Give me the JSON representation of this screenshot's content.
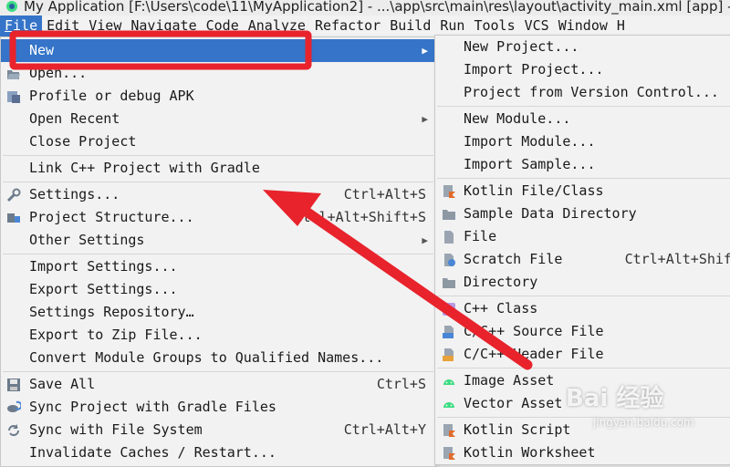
{
  "titlebar": {
    "text": "My Application [F:\\Users\\code\\11\\MyApplication2] - ...\\app\\src\\main\\res\\layout\\activity_main.xml [app] - And"
  },
  "menubar": [
    {
      "label": "File",
      "active": true
    },
    {
      "label": "Edit"
    },
    {
      "label": "View"
    },
    {
      "label": "Navigate"
    },
    {
      "label": "Code"
    },
    {
      "label": "Analyze"
    },
    {
      "label": "Refactor"
    },
    {
      "label": "Build"
    },
    {
      "label": "Run"
    },
    {
      "label": "Tools"
    },
    {
      "label": "VCS"
    },
    {
      "label": "Window"
    },
    {
      "label": "H"
    }
  ],
  "file_menu": {
    "items": [
      {
        "label": "New",
        "submenu": true,
        "selected": true,
        "icon": "none"
      },
      {
        "label": "Open...",
        "icon": "open-folder-icon"
      },
      {
        "label": "Profile or debug APK",
        "icon": "apk-icon"
      },
      {
        "label": "Open Recent",
        "submenu": true
      },
      {
        "label": "Close Project"
      },
      {
        "label": "Link C++ Project with Gradle"
      },
      {
        "label": "Settings...",
        "shortcut": "Ctrl+Alt+S",
        "icon": "wrench-icon"
      },
      {
        "label": "Project Structure...",
        "shortcut": "Ctrl+Alt+Shift+S",
        "icon": "project-structure-icon"
      },
      {
        "label": "Other Settings",
        "submenu": true
      },
      {
        "label": "Import Settings..."
      },
      {
        "label": "Export Settings..."
      },
      {
        "label": "Settings Repository…"
      },
      {
        "label": "Export to Zip File..."
      },
      {
        "label": "Convert Module Groups to Qualified Names..."
      },
      {
        "label": "Save All",
        "shortcut": "Ctrl+S",
        "icon": "save-icon"
      },
      {
        "label": "Sync Project with Gradle Files",
        "icon": "gradle-sync-icon"
      },
      {
        "label": "Sync with File System",
        "shortcut": "Ctrl+Alt+Y",
        "icon": "sync-icon"
      },
      {
        "label": "Invalidate Caches / Restart..."
      }
    ]
  },
  "new_submenu": {
    "items": [
      {
        "label": "New Project..."
      },
      {
        "label": "Import Project..."
      },
      {
        "label": "Project from Version Control..."
      },
      {
        "label": "New Module..."
      },
      {
        "label": "Import Module..."
      },
      {
        "label": "Import Sample..."
      },
      {
        "label": "Kotlin File/Class",
        "icon": "kotlin-file-icon"
      },
      {
        "label": "Sample Data Directory",
        "icon": "folder-icon"
      },
      {
        "label": "File",
        "icon": "file-icon"
      },
      {
        "label": "Scratch File",
        "shortcut": "Ctrl+Alt+Shift",
        "icon": "scratch-file-icon"
      },
      {
        "label": "Directory",
        "icon": "folder-icon"
      },
      {
        "label": "C++ Class",
        "icon": "cpp-class-icon"
      },
      {
        "label": "C/C++ Source File",
        "icon": "cpp-source-icon"
      },
      {
        "label": "C/C++ Header File",
        "icon": "cpp-header-icon"
      },
      {
        "label": "Image Asset",
        "icon": "android-icon"
      },
      {
        "label": "Vector Asset",
        "icon": "android-icon"
      },
      {
        "label": "Kotlin Script",
        "icon": "kotlin-script-icon"
      },
      {
        "label": "Kotlin Worksheet",
        "icon": "kotlin-worksheet-icon"
      }
    ]
  },
  "annotation": {
    "highlight_color": "#e8232c",
    "arrow_color": "#e8232c"
  },
  "watermark": {
    "main": "Bai 经验",
    "sub": "jingyan.baidu.com"
  },
  "colors": {
    "selection": "#3574c8",
    "menu_bg": "#f2f2f2"
  }
}
